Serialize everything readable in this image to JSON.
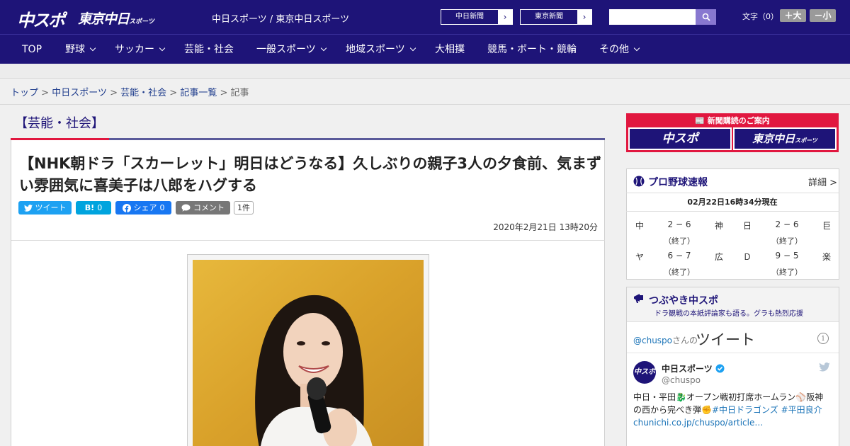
{
  "header": {
    "logo_chuspo": "中スポ",
    "logo_tokyo": "東京中日",
    "logo_tokyo_small": "スポーツ",
    "site_names": "中日スポーツ / 東京中日スポーツ",
    "paper_links": [
      "中日新聞",
      "東京新聞"
    ],
    "search_placeholder": "",
    "font_label": "文字（0）",
    "font_larger": "＋大",
    "font_smaller": "－小"
  },
  "nav": {
    "items": [
      {
        "label": "TOP",
        "dropdown": false
      },
      {
        "label": "野球",
        "dropdown": true
      },
      {
        "label": "サッカー",
        "dropdown": true
      },
      {
        "label": "芸能・社会",
        "dropdown": false
      },
      {
        "label": "一般スポーツ",
        "dropdown": true
      },
      {
        "label": "地域スポーツ",
        "dropdown": true
      },
      {
        "label": "大相撲",
        "dropdown": false
      },
      {
        "label": "競馬・ボート・競輪",
        "dropdown": false
      },
      {
        "label": "その他",
        "dropdown": true
      }
    ]
  },
  "breadcrumb": {
    "items": [
      "トップ",
      "中日スポーツ",
      "芸能・社会",
      "記事一覧"
    ],
    "current": "記事",
    "separator": ">"
  },
  "article": {
    "category": "【芸能・社会】",
    "headline": "【NHK朝ドラ「スカーレット」明日はどうなる】久しぶりの親子3人の夕食前、気まずい雰囲気に喜美子は八郎をハグする",
    "share": {
      "tweet_label": "ツイート",
      "hatena_label": "B!",
      "hatena_count": "0",
      "facebook_label": "シェア",
      "facebook_count": "0",
      "comment_label": "コメント",
      "comment_count": "1件"
    },
    "date": "2020年2月21日 13時20分"
  },
  "sidebar": {
    "subscription": {
      "title": "新聞購読のご案内",
      "logo_left": "中スポ",
      "logo_right": "東京中日",
      "logo_right_small": "スポーツ"
    },
    "scores": {
      "title": "プロ野球速報",
      "detail_link": "詳細 >",
      "updated": "02月22日16時34分現在",
      "games": [
        {
          "home": "中",
          "score": "2 − 6",
          "away": "神",
          "status": "（終了）"
        },
        {
          "home": "日",
          "score": "2 − 6",
          "away": "巨",
          "status": "（終了）"
        },
        {
          "home": "ヤ",
          "score": "6 − 7",
          "away": "広",
          "status": "（終了）"
        },
        {
          "home": "Ｄ",
          "score": "9 − 5",
          "away": "楽",
          "status": "（終了）"
        }
      ]
    },
    "twitter": {
      "title": "つぶやき中スポ",
      "subtitle": "ドラ観戦の本紙評論家も語る。グラも熱烈応援",
      "handle_link": "@chuspo",
      "handle_suffix": "さんの",
      "heading": "ツイート",
      "author": "中日スポーツ",
      "author_handle": "@chuspo",
      "avatar_text": "中スポ",
      "tweet_text": "中日・平田",
      "tweet_text2": "オープン戦初打席ホームラン",
      "tweet_text3": "阪神の西から完べき弾",
      "tag1": "#中日ドラゴンズ",
      "tag2": "#平田良介",
      "link": "chunichi.co.jp/chuspo/article…"
    }
  },
  "colors": {
    "brand_navy": "#1e1478",
    "accent_red": "#e1173f",
    "twitter_blue": "#1da1f2",
    "hatena_blue": "#00a4de",
    "facebook_blue": "#1877f2",
    "comment_gray": "#777777"
  }
}
